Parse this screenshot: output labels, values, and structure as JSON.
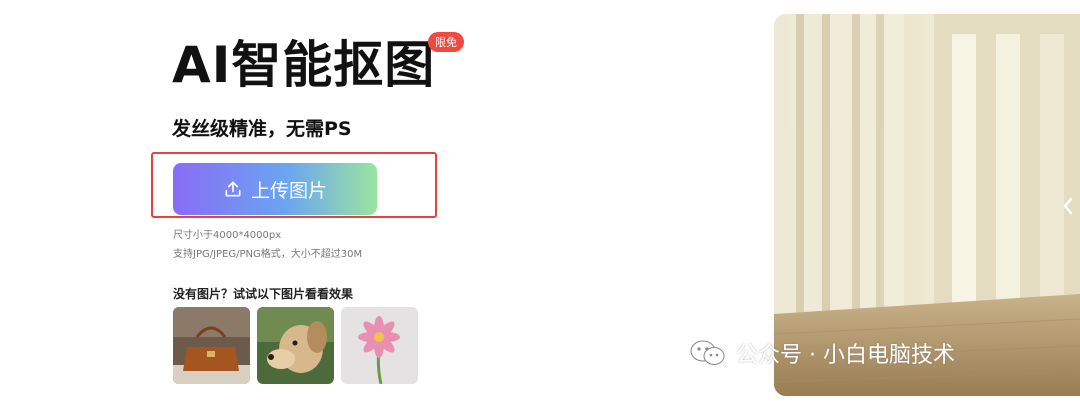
{
  "hero": {
    "title": "AI智能抠图",
    "badge": "限免",
    "subtitle": "发丝级精准，无需PS"
  },
  "upload": {
    "button_label": "上传图片",
    "icon": "upload-icon",
    "size_hint": "尺寸小于4000*4000px",
    "format_hint": "支持JPG/JPEG/PNG格式，大小不超过30M"
  },
  "samples": {
    "title": "没有图片？试试以下图片看看效果",
    "items": [
      "handbag-sample",
      "dog-sample",
      "flower-sample"
    ]
  },
  "watermark": {
    "text": "公众号 · 小白电脑技术",
    "icon": "wechat-icon"
  },
  "colors": {
    "badge": "#f0493f",
    "highlight": "#e0443a",
    "button_start": "#8a6cf6",
    "button_end": "#9ae4a0"
  }
}
